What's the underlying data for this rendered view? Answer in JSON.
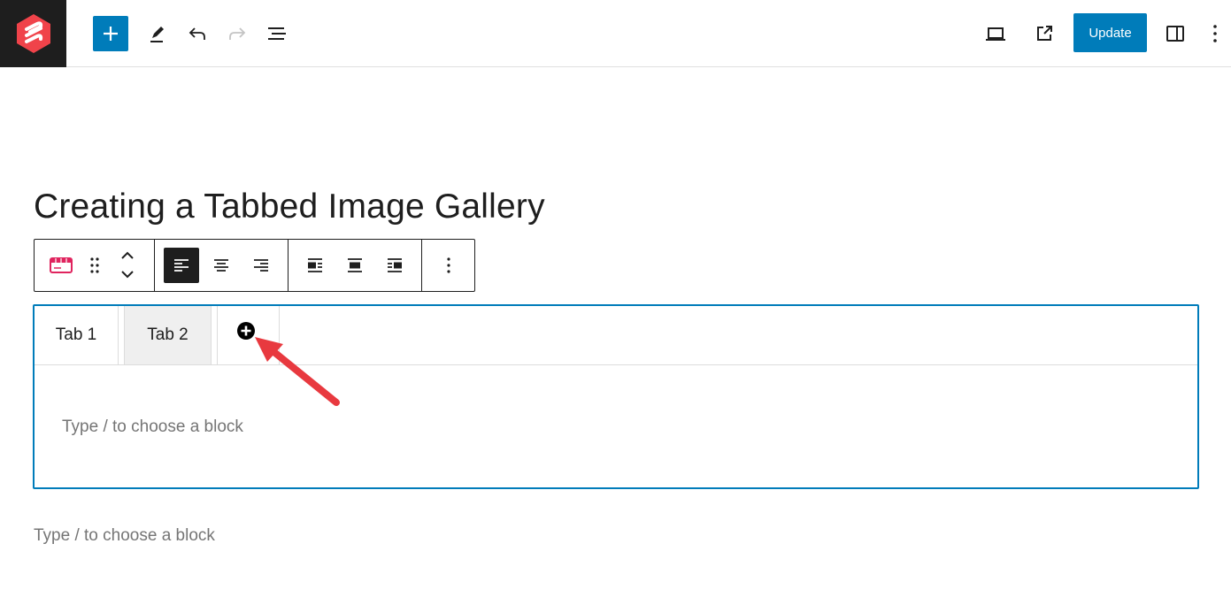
{
  "topbar": {
    "site_icon": "wordpress-site-logo-icon",
    "inserter_icon": "plus-icon",
    "tools_icon": "pencil-icon",
    "undo_icon": "undo-icon",
    "redo_icon": "redo-icon",
    "list_view_icon": "list-view-icon",
    "preview_icon": "desktop-preview-icon",
    "view_post_icon": "external-link-icon",
    "update_label": "Update",
    "settings_icon": "sidebar-settings-icon",
    "options_icon": "more-vertical-icon"
  },
  "post": {
    "title": "Creating a Tabbed Image Gallery"
  },
  "block_toolbar": {
    "block_icon": "tabs-block-icon",
    "drag_icon": "drag-handle-icon",
    "move_up_icon": "chevron-up-icon",
    "move_down_icon": "chevron-down-icon",
    "align_icons": [
      "align-left-icon",
      "align-center-icon",
      "align-right-icon"
    ],
    "layout_icons": [
      "wrap-left-icon",
      "wrap-center-icon",
      "wrap-right-icon"
    ],
    "options_icon": "more-vertical-icon"
  },
  "tabs_block": {
    "tabs": [
      {
        "label": "Tab 1"
      },
      {
        "label": "Tab 2"
      }
    ],
    "add_tab_icon": "plus-circle-icon",
    "content_placeholder": "Type / to choose a block"
  },
  "editor": {
    "next_block_placeholder": "Type / to choose a block"
  },
  "colors": {
    "accent": "#007cba",
    "arrow": "#e8393f",
    "logo_red": "#f0434a",
    "dark": "#1e1e1e"
  }
}
